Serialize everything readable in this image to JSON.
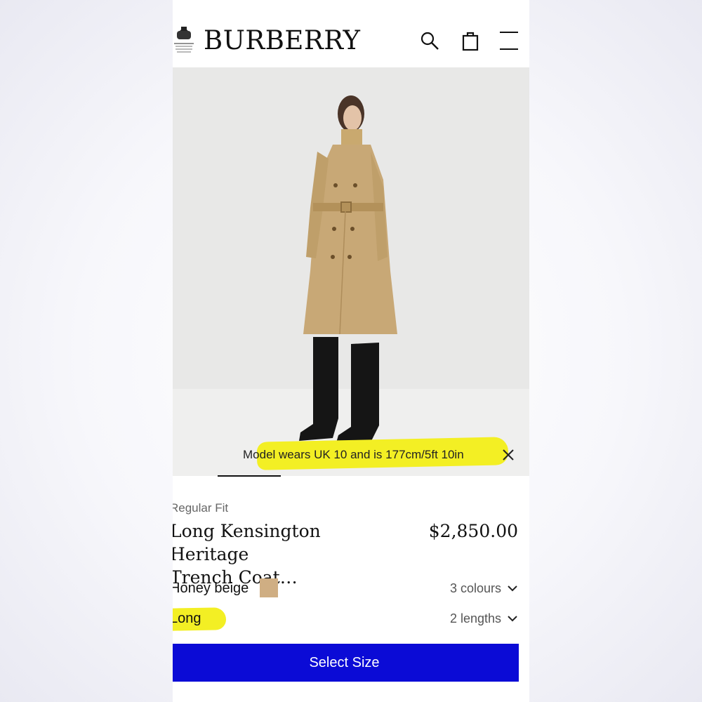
{
  "header": {
    "brand": "BURBERRY",
    "crest_icon": "royal-warrant-crest-icon",
    "icons": [
      "search-icon",
      "shopping-bag-icon",
      "menu-icon"
    ]
  },
  "hero": {
    "image": "model-in-beige-trench-coat-and-black-boots",
    "caption": "Model wears UK 10 and is 177cm/5ft 10in",
    "close_icon": "close-icon",
    "highlight_color": "#f3ef24"
  },
  "product": {
    "fit": "Regular Fit",
    "title_line1": "Long Kensington Heritage",
    "title_line2": "Trench Coat…",
    "price": "$2,850.00",
    "colour": {
      "name": "Honey beige",
      "swatch_color": "#cfae83",
      "count_label": "3 colours"
    },
    "length": {
      "name": "Long",
      "count_label": "2 lengths"
    }
  },
  "cta": {
    "label": "Select Size",
    "color": "#0b0bd6"
  }
}
